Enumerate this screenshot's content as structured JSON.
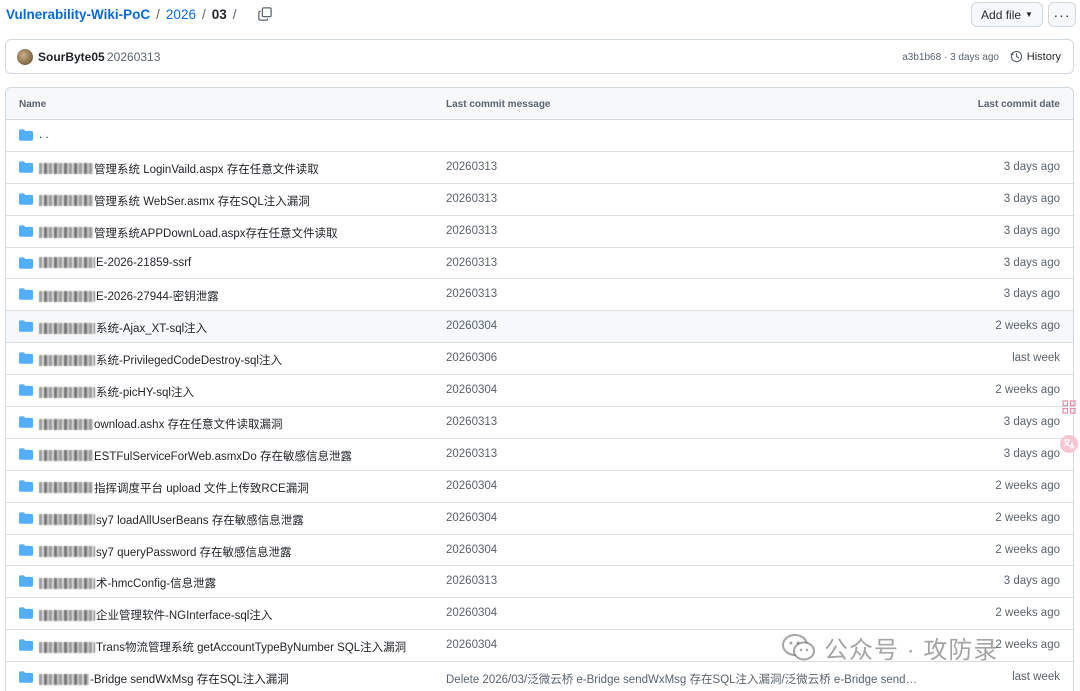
{
  "breadcrumb": {
    "repo": "Vulnerability-Wiki-PoC",
    "sep": "/",
    "year": "2026",
    "month": "03"
  },
  "header": {
    "add_file": "Add file",
    "more": "···"
  },
  "commit": {
    "user": "SourByte05",
    "message": "20260313",
    "meta": "a3b1b68 · 3 days ago",
    "history": "History"
  },
  "table": {
    "col_name": "Name",
    "col_msg": "Last commit message",
    "col_date": "Last commit date",
    "parent": ". .",
    "rows": [
      {
        "blur": 54,
        "name": "管理系统 LoginVaild.aspx 存在任意文件读取",
        "msg": "20260313",
        "date": "3 days ago"
      },
      {
        "blur": 54,
        "name": "管理系统 WebSer.asmx 存在SQL注入漏洞",
        "msg": "20260313",
        "date": "3 days ago"
      },
      {
        "blur": 54,
        "name": "管理系统APPDownLoad.aspx存在任意文件读取",
        "msg": "20260313",
        "date": "3 days ago"
      },
      {
        "blur": 56,
        "name": "E-2026-21859-ssrf",
        "msg": "20260313",
        "date": "3 days ago"
      },
      {
        "blur": 56,
        "name": "E-2026-27944-密钥泄露",
        "msg": "20260313",
        "date": "3 days ago"
      },
      {
        "blur": 56,
        "name": "系统-Ajax_XT-sql注入",
        "msg": "20260304",
        "date": "2 weeks ago"
      },
      {
        "blur": 56,
        "name": "系统-PrivilegedCodeDestroy-sql注入",
        "msg": "20260306",
        "date": "last week"
      },
      {
        "blur": 56,
        "name": "系统-picHY-sql注入",
        "msg": "20260304",
        "date": "2 weeks ago"
      },
      {
        "blur": 54,
        "name": "ownload.ashx 存在任意文件读取漏洞",
        "msg": "20260313",
        "date": "3 days ago"
      },
      {
        "blur": 54,
        "name": "ESTFulServiceForWeb.asmxDo 存在敏感信息泄露",
        "msg": "20260313",
        "date": "3 days ago"
      },
      {
        "blur": 54,
        "name": "指挥调度平台 upload 文件上传致RCE漏洞",
        "msg": "20260304",
        "date": "2 weeks ago"
      },
      {
        "blur": 56,
        "name": "sy7 loadAllUserBeans 存在敏感信息泄露",
        "msg": "20260304",
        "date": "2 weeks ago"
      },
      {
        "blur": 56,
        "name": "sy7 queryPassword 存在敏感信息泄露",
        "msg": "20260304",
        "date": "2 weeks ago"
      },
      {
        "blur": 56,
        "name": "术-hmcConfig-信息泄露",
        "msg": "20260313",
        "date": "3 days ago"
      },
      {
        "blur": 56,
        "name": "企业管理软件-NGInterface-sql注入",
        "msg": "20260304",
        "date": "2 weeks ago"
      },
      {
        "blur": 56,
        "name": "Trans物流管理系统 getAccountTypeByNumber SQL注入漏洞",
        "msg": "20260304",
        "date": "2 weeks ago"
      },
      {
        "blur": 50,
        "name": "-Bridge sendWxMsg 存在SQL注入漏洞",
        "msg": "Delete 2026/03/泛微云桥 e-Bridge sendWxMsg 存在SQL注入漏洞/泛微云桥 e-Bridge sendWx...",
        "date": "last week"
      }
    ]
  },
  "watermark": "公众号 · 攻防录",
  "icons": {
    "copy": "copy-icon",
    "folder": "folder-icon",
    "history": "history-icon",
    "side_grid": "apps-grid-icon",
    "side_translate": "translate-icon",
    "wechat": "wechat-icon"
  },
  "colors": {
    "link": "#0969da",
    "folder": "#54aeff"
  }
}
